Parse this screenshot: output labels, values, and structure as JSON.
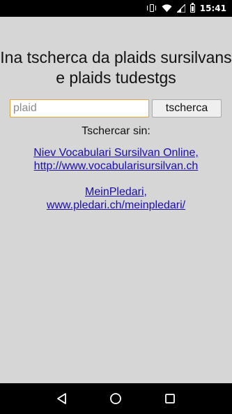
{
  "status_bar": {
    "time": "15:41",
    "icons": [
      "vibrate-icon",
      "wifi-icon",
      "signal-icon",
      "battery-icon"
    ]
  },
  "main": {
    "title": "Ina tscherca da plaids sursilvans e plaids tudestgs",
    "search": {
      "placeholder": "plaid",
      "value": ""
    },
    "search_button_label": "tscherca",
    "search_in_label": "Tschercar sin:",
    "links": [
      {
        "line1": "Niev Vocabulari Sursilvan Online,",
        "line2": "http://www.vocabularisursilvan.ch"
      },
      {
        "line1": "MeinPledari,",
        "line2": "www.pledari.ch/meinpledari/"
      }
    ]
  },
  "nav_bar": {
    "buttons": [
      "back-icon",
      "home-icon",
      "recents-icon"
    ]
  },
  "colors": {
    "background": "#d6d6d6",
    "input_focus_border": "#e6a33b",
    "link": "#1a0dab",
    "bars": "#000000"
  }
}
